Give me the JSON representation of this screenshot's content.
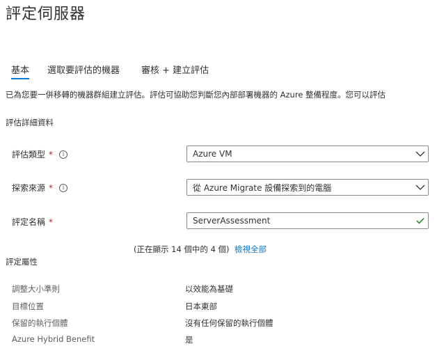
{
  "page": {
    "title": "評定伺服器"
  },
  "tabs": [
    {
      "label": "基本",
      "active": true
    },
    {
      "label": "選取要評估的機器"
    },
    {
      "label": "審核 + 建立評估"
    }
  ],
  "description": "已為您要一併移轉的機器群組建立評估。評估可協助您判斷您內部部署機器的 Azure 整備程度。您可以評估",
  "section_title": "評估詳細資料",
  "form": {
    "assessment_type": {
      "label": "評估類型",
      "required": "*",
      "value": "Azure VM"
    },
    "discovery_source": {
      "label": "探索來源",
      "required": "*",
      "value": "從 Azure Migrate 設備探索到的電腦"
    },
    "assessment_name": {
      "label": "評定名稱",
      "required": "*",
      "value": "ServerAssessment"
    }
  },
  "properties": {
    "title": "評定屬性",
    "showing": "(正在顯示 14 個中的 4 個)",
    "view_all": "檢視全部",
    "rows": [
      {
        "label": "調整大小準則",
        "value": "以效能為基礎"
      },
      {
        "label": "目標位置",
        "value": "日本東部"
      },
      {
        "label": "保留的執行個體",
        "value": "沒有任何保留的執行個體"
      },
      {
        "label": "Azure Hybrid Benefit",
        "value": "是"
      }
    ]
  },
  "colors": {
    "accent": "#0078d4",
    "required": "#a4262c",
    "valid": "#107c10",
    "border": "#8a8886"
  },
  "icons": {
    "info": "info-icon",
    "dropdown": "chevron-down-icon",
    "valid": "checkmark-icon"
  }
}
